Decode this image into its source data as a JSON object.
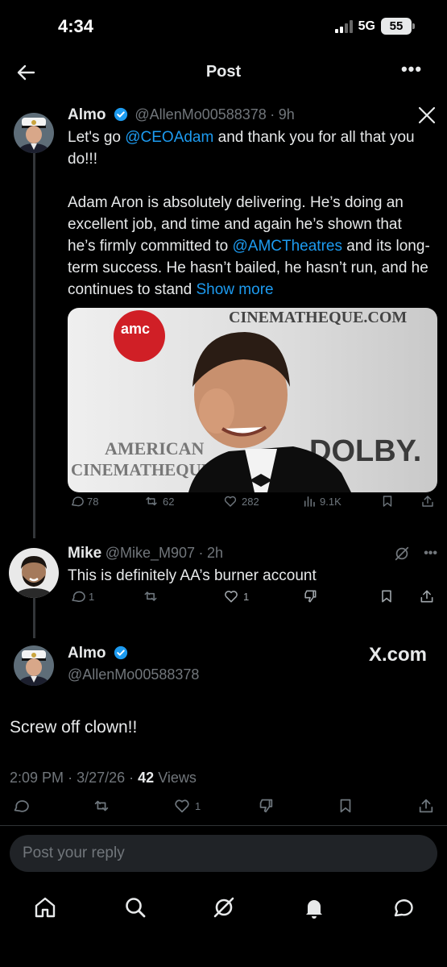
{
  "status_bar": {
    "time": "4:34",
    "network": "5G",
    "battery": "55"
  },
  "header": {
    "title": "Post",
    "more": "•••"
  },
  "tweet1": {
    "name": "Almo",
    "handle": "@AllenMo00588378",
    "sep": "·",
    "time": "9h",
    "body1_pre": "Let's go ",
    "mention1": "@CEOAdam",
    "body1_post": " and thank you for all that you do!!!",
    "body2_pre": "Adam Aron is absolutely delivering. He’s doing an excellent job, and time and again he’s shown that he’s firmly committed to ",
    "mention2": "@AMCTheatres",
    "body2_post": " and its long-term success. He hasn’t bailed, he hasn’t run, and he continues to stand ",
    "show_more": "Show more",
    "media_texts": {
      "logo": "amc",
      "backdrop_top": "CINEMATHEQUE.COM",
      "backdrop_left1": "AMERICAN",
      "backdrop_left2": "CINEMATHEQUE.COM",
      "backdrop_right": "DOLBY."
    },
    "stats": {
      "replies": "78",
      "retweets": "62",
      "likes": "282",
      "views": "9.1K"
    }
  },
  "tweet2": {
    "name": "Mike",
    "handle": "@Mike_M907",
    "sep": "·",
    "time": "2h",
    "body": "This is definitely AA’s burner account",
    "stats": {
      "replies": "1",
      "likes": "1"
    },
    "more": "•••"
  },
  "tweet3": {
    "name": "Almo",
    "handle": "@AllenMo00588378",
    "watermark": "X.com",
    "body": "Screw off clown!!",
    "time": "2:09 PM",
    "sep": "·",
    "date": "3/27/26",
    "views_count": "42",
    "views_label": "Views",
    "stats": {
      "likes": "1"
    }
  },
  "reply": {
    "placeholder": "Post your reply"
  },
  "colors": {
    "background": "#000000",
    "text": "#e7e9ea",
    "muted": "#71767b",
    "link": "#1d9bf0",
    "verified": "#1d9bf0"
  },
  "icons": {
    "back": "arrow-left-icon",
    "more": "more-horizontal-icon",
    "x_logo": "x-logo-icon",
    "verified": "verified-badge-icon",
    "reply": "reply-icon",
    "retweet": "retweet-icon",
    "like": "heart-icon",
    "views": "views-icon",
    "bookmark": "bookmark-icon",
    "share": "share-icon",
    "grok": "grok-icon",
    "dislike": "dislike-icon",
    "home": "home-icon",
    "search": "search-icon",
    "notifications": "bell-icon",
    "messages": "messages-icon"
  }
}
